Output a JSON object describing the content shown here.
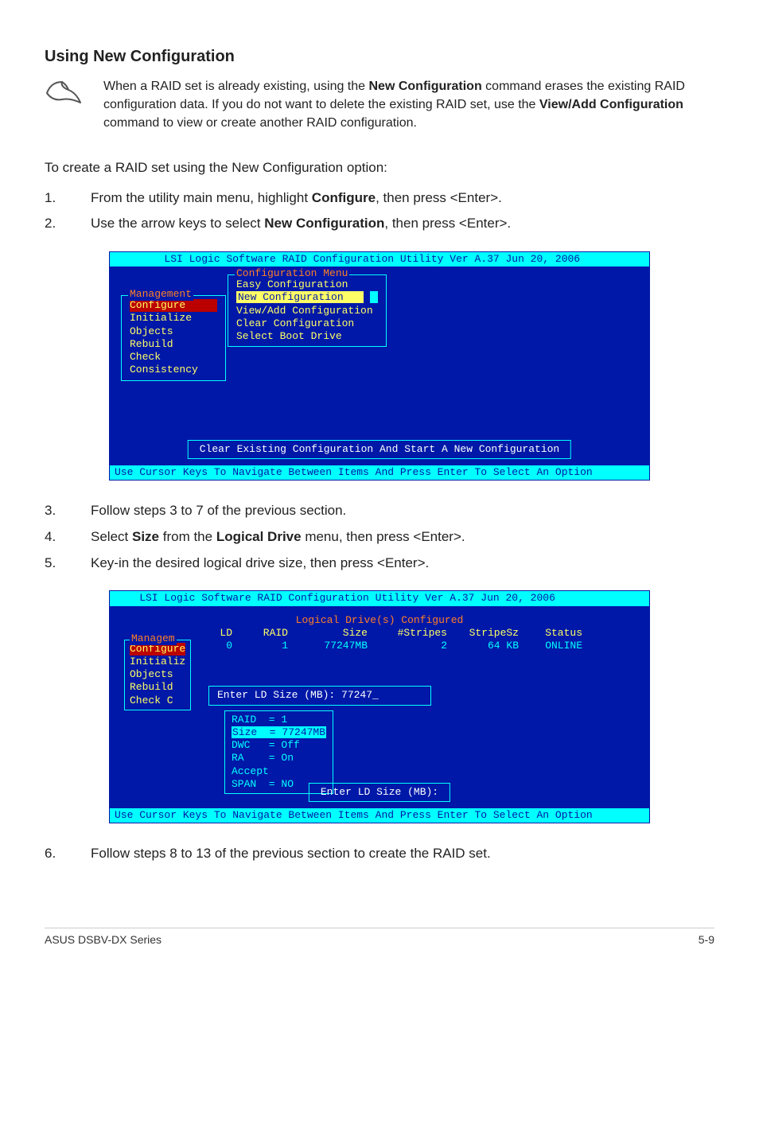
{
  "heading": "Using New Configuration",
  "note": {
    "line1_a": "When a RAID set is already existing, using the ",
    "bold1": "New Configuration",
    "line1_b": " command erases the existing RAID configuration data. If you do not want to delete the existing RAID set, use the ",
    "bold2": "View/Add Configuration",
    "line1_c": " command to view or create another RAID configuration."
  },
  "intro": "To create a RAID set using the New Configuration option:",
  "steps_a": [
    {
      "n": "1.",
      "pre": "From the utility main menu, highlight ",
      "b": "Configure",
      "post": ", then press <Enter>."
    },
    {
      "n": "2.",
      "pre": "Use the arrow keys to select ",
      "b": "New Configuration",
      "post": ", then press <Enter>."
    }
  ],
  "bios1": {
    "topbar": "        LSI Logic Software RAID Configuration Utility Ver A.37 Jun 20, 2006",
    "mgmt_label": "Management",
    "mgmt_items": [
      "Configure",
      "Initialize",
      "Objects",
      "Rebuild",
      "Check Consistency"
    ],
    "cfg_title": "Configuration Menu",
    "cfg_items": [
      {
        "t": "Easy Configuration",
        "sel": false
      },
      {
        "t": "New Configuration   ",
        "sel": true
      },
      {
        "t": "View/Add Configuration",
        "sel": false
      },
      {
        "t": "Clear Configuration",
        "sel": false
      },
      {
        "t": "Select Boot Drive",
        "sel": false
      }
    ],
    "bottom": "Clear Existing Configuration And Start A New Configuration",
    "botbar": "Use Cursor Keys To Navigate Between Items And Press Enter To Select An Option"
  },
  "steps_b": [
    {
      "n": "3.",
      "pre": "Follow steps 3 to 7 of the previous section.",
      "b": "",
      "post": ""
    },
    {
      "n": "4.",
      "pre": "Select ",
      "b": "Size",
      "mid": " from the ",
      "b2": "Logical Drive",
      "post": " menu, then press <Enter>."
    },
    {
      "n": "5.",
      "pre": "Key-in the desired logical drive size, then press <Enter>.",
      "b": "",
      "post": ""
    }
  ],
  "bios2": {
    "topbar": "    LSI Logic Software RAID Configuration Utility Ver A.37 Jun 20, 2006",
    "ld_header": "Logical Drive(s) Configured",
    "cols": [
      "LD",
      "RAID",
      "Size",
      "#Stripes",
      "StripeSz",
      "Status"
    ],
    "row": [
      "0",
      "1",
      "77247MB",
      "2",
      "64  KB",
      "ONLINE"
    ],
    "side_label": "Managem",
    "side_items": [
      "Configure",
      "Initializ",
      "Objects",
      "Rebuild",
      "Check C"
    ],
    "size_prompt": "Enter LD Size (MB): 77247_",
    "params": [
      "RAID  = 1",
      "Size  = 77247MB",
      "DWC   = Off",
      "RA    = On",
      "Accept",
      "SPAN  = NO"
    ],
    "bottom": "Enter LD Size (MB):",
    "botbar": "Use Cursor Keys To Navigate Between Items And Press Enter To Select An Option"
  },
  "steps_c": [
    {
      "n": "6.",
      "pre": "Follow steps 8 to 13 of the previous section to create the RAID set.",
      "b": "",
      "post": ""
    }
  ],
  "footer": {
    "left": "ASUS DSBV-DX Series",
    "right": "5-9"
  }
}
